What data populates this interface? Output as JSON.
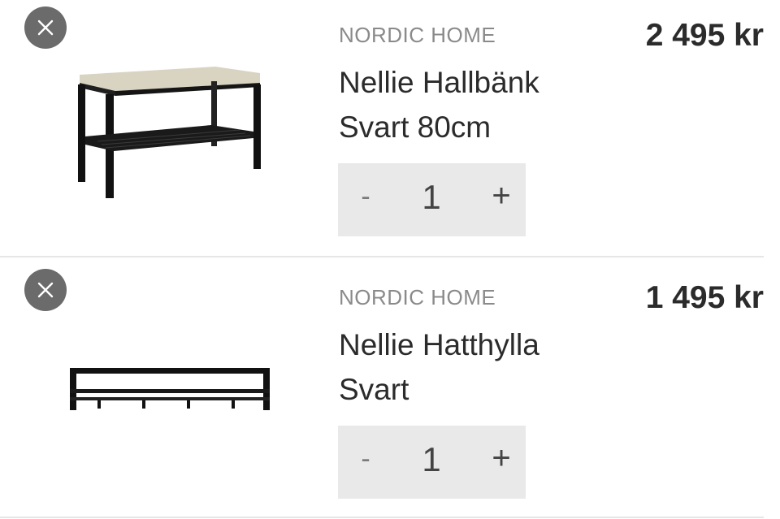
{
  "cart": {
    "items": [
      {
        "brand": "NORDIC HOME",
        "name_line1": "Nellie Hallbänk",
        "name_line2": "Svart 80cm",
        "price": "2 495 kr",
        "quantity": "1",
        "minus_label": "-",
        "plus_label": "+",
        "image_icon": "bench-image"
      },
      {
        "brand": "NORDIC HOME",
        "name_line1": "Nellie Hatthylla",
        "name_line2": "Svart",
        "price": "1 495 kr",
        "quantity": "1",
        "minus_label": "-",
        "plus_label": "+",
        "image_icon": "hat-shelf-image"
      }
    ],
    "remove_icon": "close-icon",
    "colors": {
      "remove_bg": "#6b6b6b",
      "qty_bg": "#e9e9e9",
      "text": "#2b2b2b",
      "brand_text": "#8a8a8a"
    }
  }
}
